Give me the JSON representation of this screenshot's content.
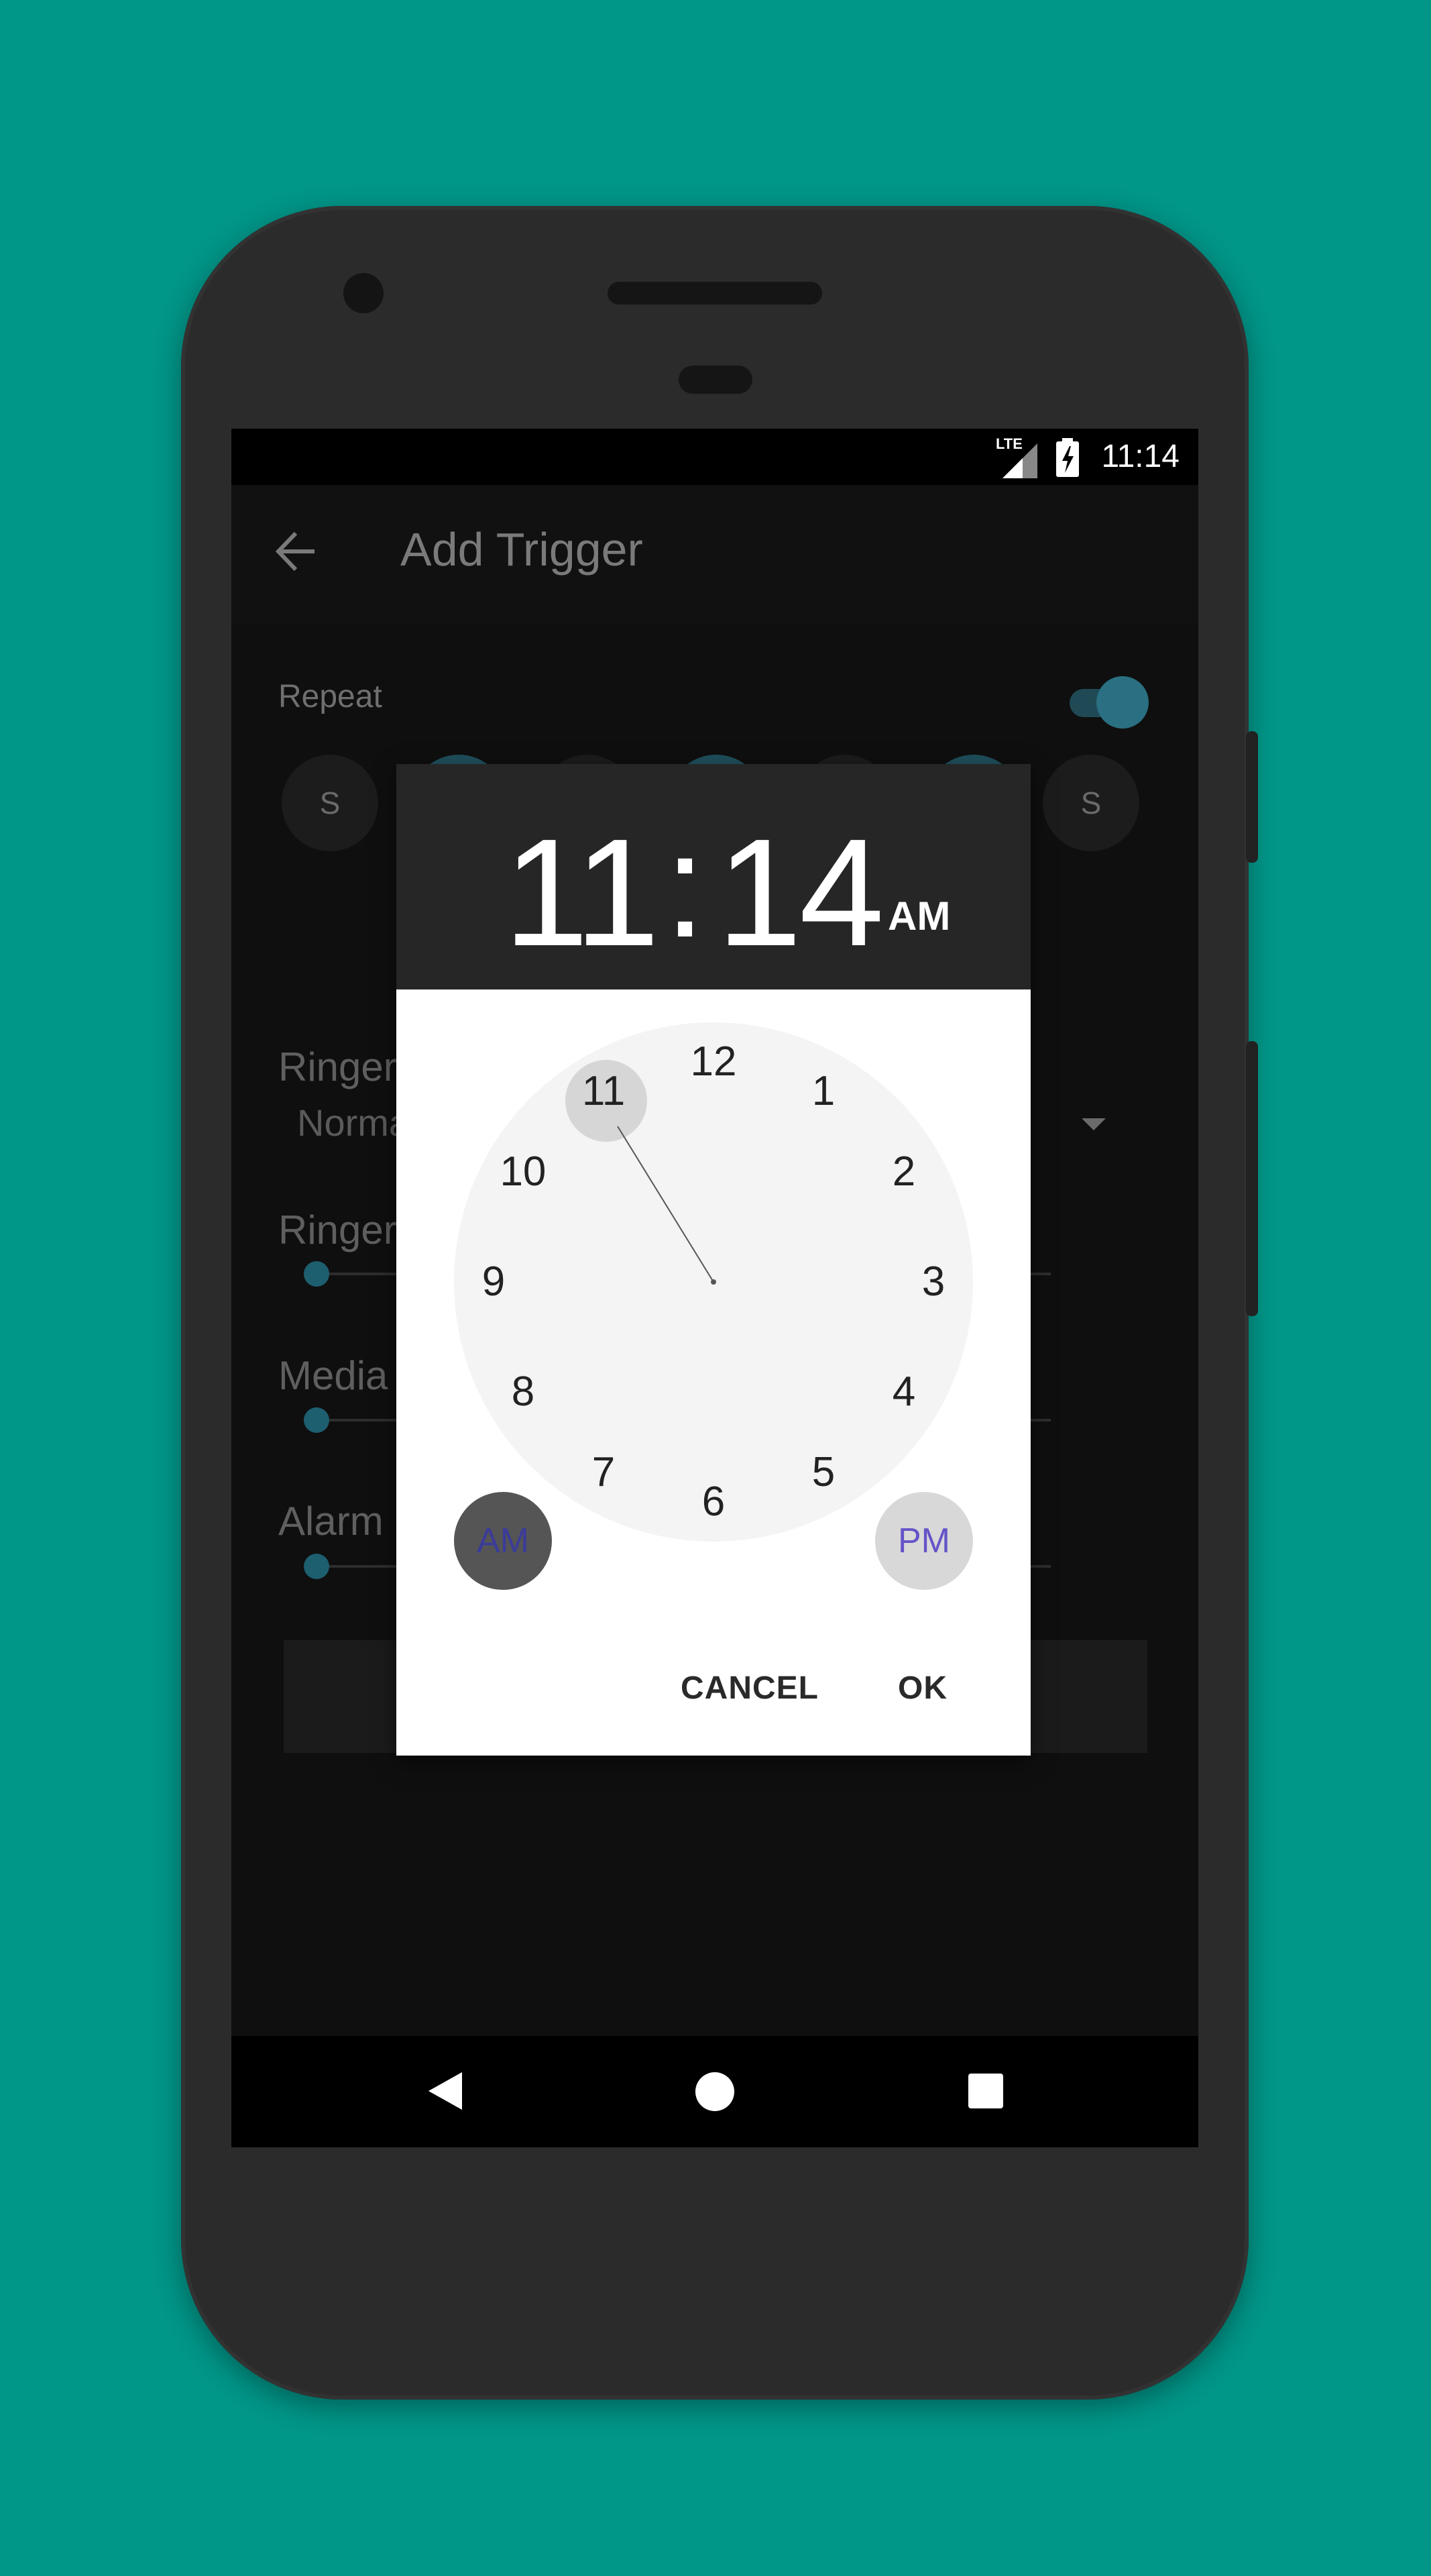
{
  "status_bar": {
    "time": "11:14",
    "network": "LTE"
  },
  "app_bar": {
    "title": "Add Trigger"
  },
  "repeat": {
    "label": "Repeat",
    "days": [
      {
        "label": "S",
        "selected": false
      },
      {
        "label": "",
        "selected": true
      },
      {
        "label": "",
        "selected": false
      },
      {
        "label": "",
        "selected": true
      },
      {
        "label": "",
        "selected": false
      },
      {
        "label": "",
        "selected": true
      },
      {
        "label": "S",
        "selected": false
      }
    ]
  },
  "form": {
    "ringer_mode_label": "Ringer",
    "ringer_mode_value": "Norma",
    "ringer_volume_label": "Ringer",
    "media_volume_label": "Media",
    "alarm_volume_label": "Alarm"
  },
  "time_picker": {
    "hour": "11",
    "colon": ":",
    "minute": "14",
    "period": "AM",
    "selected_hour": "11",
    "clock_numbers": [
      "12",
      "1",
      "2",
      "3",
      "4",
      "5",
      "6",
      "7",
      "8",
      "9",
      "10",
      "11"
    ],
    "am_label": "AM",
    "pm_label": "PM",
    "cancel_label": "CANCEL",
    "ok_label": "OK"
  },
  "colors": {
    "background": "#009688",
    "accent": "#2a6f82",
    "am_selected": "#555555",
    "pm_text": "#6454c8"
  },
  "icons": {
    "back": "arrow-back-icon",
    "nav_back": "triangle-back-icon",
    "nav_home": "circle-home-icon",
    "nav_recents": "square-recents-icon"
  }
}
